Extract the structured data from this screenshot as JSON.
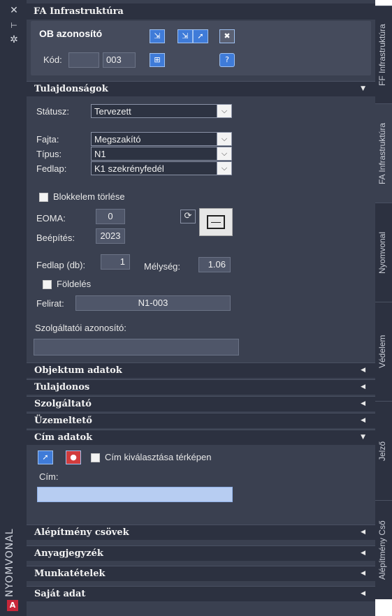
{
  "left_bar": {
    "vertical_label": "NYOMVONAL",
    "logo_letter": "A"
  },
  "panel": {
    "title": "FA Infrastruktúra",
    "ob": {
      "label": "OB azonosító",
      "kod_label": "Kód:",
      "kod_prefix": "",
      "kod_value": "003"
    },
    "tulajdonsagok": {
      "header": "Tulajdonságok",
      "statusz_label": "Státusz:",
      "statusz_value": "Tervezett",
      "fajta_label": "Fajta:",
      "fajta_value": "Megszakító",
      "tipus_label": "Típus:",
      "tipus_value": "N1",
      "fedlap_label": "Fedlap:",
      "fedlap_value": "K1 szekrényfedél",
      "blokk_label": "Blokkelem törlése",
      "eoma_label": "EOMA:",
      "eoma_value": "0",
      "beepites_label": "Beépítés:",
      "beepites_value": "2023",
      "fedlap_db_label": "Fedlap (db):",
      "fedlap_db_value": "1",
      "melyseg_label": "Mélység:",
      "melyseg_value": "1.06",
      "foldeles_label": "Földelés",
      "felirat_label": "Felirat:",
      "felirat_value": "N1-003",
      "szolg_azon_label": "Szolgáltatói azonosító:",
      "szolg_azon_value": ""
    },
    "sections_collapsed_1": [
      "Objektum adatok",
      "Tulajdonos",
      "Szolgáltató",
      "Üzemeltető"
    ],
    "cim": {
      "header": "Cím adatok",
      "check_label": "Cím kiválasztása térképen",
      "cim_label": "Cím:",
      "cim_value": ""
    },
    "sections_collapsed_2": [
      "Alépítmény csövek",
      "Anyagjegyzék",
      "Munkatételek",
      "Saját adat"
    ]
  },
  "right_tabs": [
    "FF Infrastruktúra",
    "FA Infrastruktúra",
    "Nyomvonal",
    "Védelem",
    "Jelző",
    "Alépítmény Cső"
  ],
  "colors": {
    "panel_bg": "#3a4050",
    "header_bg": "#2c3140",
    "accent_blue": "#3f7bd8",
    "cim_field": "#b7cdf2"
  }
}
